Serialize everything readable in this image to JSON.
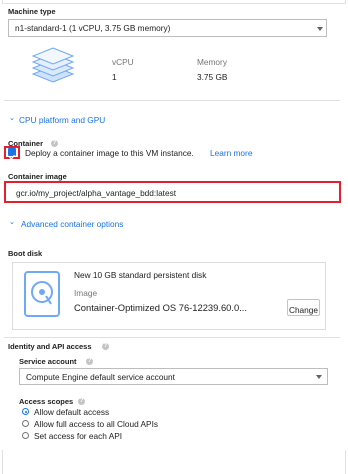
{
  "machine": {
    "label": "Machine type",
    "selected": "n1-standard-1 (1 vCPU, 3.75 GB memory)",
    "vcpu_header": "vCPU",
    "memory_header": "Memory",
    "vcpu_value": "1",
    "memory_value": "3.75 GB",
    "icon": "layers-icon"
  },
  "cpu_platform_link": "CPU platform and GPU",
  "container": {
    "label": "Container",
    "checkbox_label": "Deploy a container image to this VM instance.",
    "learn_more": "Learn more",
    "checked": true,
    "image_label": "Container image",
    "image_value": "gcr.io/my_project/alpha_vantage_bdd:latest",
    "advanced_link": "Advanced container options"
  },
  "boot_disk": {
    "label": "Boot disk",
    "title": "New 10 GB standard persistent disk",
    "image_caption": "Image",
    "image_name": "Container-Optimized OS 76-12239.60.0...",
    "change_button": "Change",
    "icon": "disk-icon"
  },
  "identity": {
    "label": "Identity and API access",
    "service_account_label": "Service account",
    "service_account_value": "Compute Engine default service account",
    "scopes_label": "Access scopes",
    "scopes": [
      {
        "label": "Allow default access",
        "selected": true
      },
      {
        "label": "Allow full access to all Cloud APIs",
        "selected": false
      },
      {
        "label": "Set access for each API",
        "selected": false
      }
    ]
  },
  "colors": {
    "accent": "#1a73e8",
    "highlight_border": "#e5202e",
    "checkbox_fill": "#1a73e8"
  }
}
